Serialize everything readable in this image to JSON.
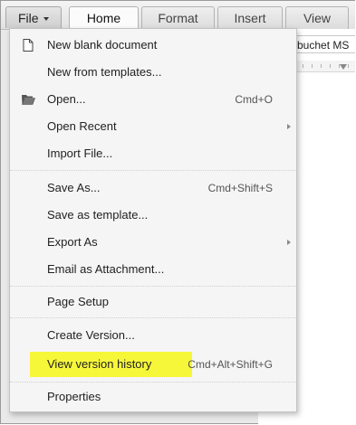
{
  "tabs": {
    "file": "File",
    "home": "Home",
    "format": "Format",
    "insert": "Insert",
    "view": "View"
  },
  "toolbar": {
    "font_name": "buchet MS"
  },
  "menu": {
    "new_blank": "New blank document",
    "new_templates": "New from templates...",
    "open": "Open...",
    "open_shortcut": "Cmd+O",
    "open_recent": "Open Recent",
    "import": "Import File...",
    "save_as": "Save As...",
    "save_as_shortcut": "Cmd+Shift+S",
    "save_template": "Save as template...",
    "export_as": "Export As",
    "email": "Email as Attachment...",
    "page_setup": "Page Setup",
    "create_version": "Create Version...",
    "version_history": "View version history",
    "version_history_shortcut": "Cmd+Alt+Shift+G",
    "properties": "Properties"
  },
  "colors": {
    "highlight": "#f7f73a"
  },
  "icons": {
    "new_blank": "document-icon",
    "open": "folder-icon",
    "submenu": "chevron-right-icon",
    "file_menu": "caret-down-icon"
  }
}
